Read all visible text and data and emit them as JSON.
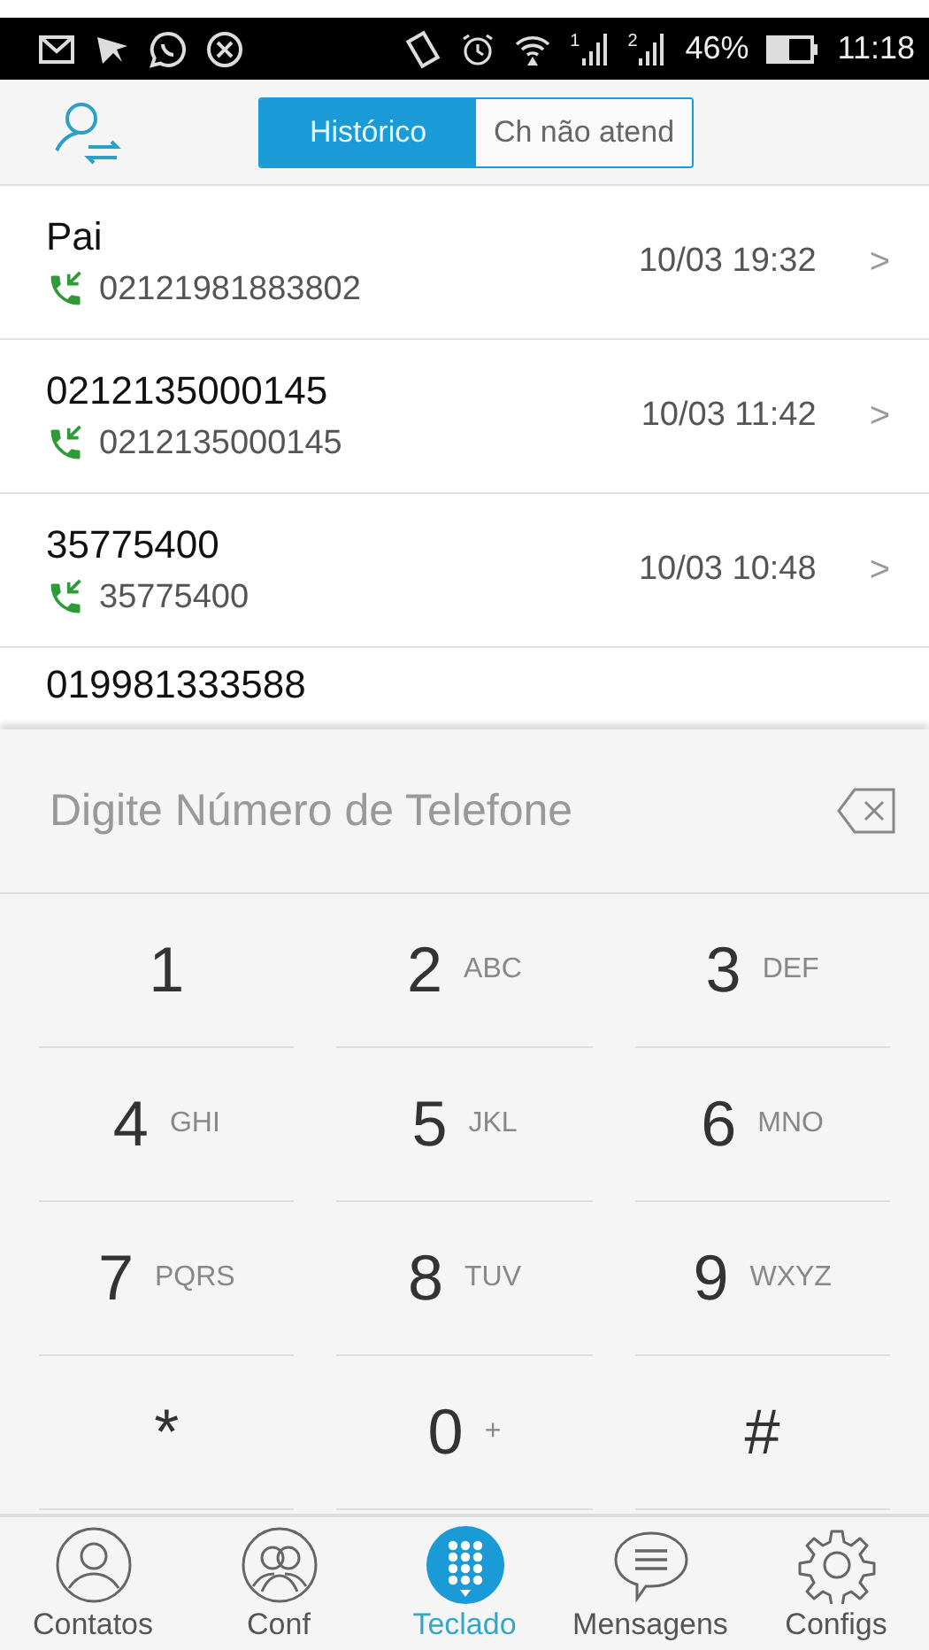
{
  "status_bar": {
    "sim_slots": [
      "1",
      "2"
    ],
    "battery": "46%",
    "time": "11:18"
  },
  "header": {
    "tabs": [
      {
        "label": "Histórico",
        "selected": true
      },
      {
        "label": "Ch não atend",
        "selected": false
      }
    ]
  },
  "calls": [
    {
      "name": "Pai",
      "number": "02121981883802",
      "time": "10/03 19:32",
      "chevron": ">"
    },
    {
      "name": "0212135000145",
      "number": "0212135000145",
      "time": "10/03 11:42",
      "chevron": ">"
    },
    {
      "name": "35775400",
      "number": "35775400",
      "time": "10/03 10:48",
      "chevron": ">"
    },
    {
      "name": "019981333588"
    }
  ],
  "dialer": {
    "placeholder": "Digite Número de Telefone",
    "keys": [
      {
        "digit": "1"
      },
      {
        "digit": "2",
        "letters": "ABC"
      },
      {
        "digit": "3",
        "letters": "DEF"
      },
      {
        "digit": "4",
        "letters": "GHI"
      },
      {
        "digit": "5",
        "letters": "JKL"
      },
      {
        "digit": "6",
        "letters": "MNO"
      },
      {
        "digit": "7",
        "letters": "PQRS"
      },
      {
        "digit": "8",
        "letters": "TUV"
      },
      {
        "digit": "9",
        "letters": "WXYZ"
      },
      {
        "digit": "*"
      },
      {
        "digit": "0",
        "letters": "+"
      },
      {
        "digit": "#"
      }
    ]
  },
  "nav": [
    {
      "kind": "contacts",
      "label": "Contatos",
      "selected": false
    },
    {
      "kind": "conf",
      "label": "Conf",
      "selected": false
    },
    {
      "kind": "keypad",
      "label": "Teclado",
      "selected": true
    },
    {
      "kind": "messages",
      "label": "Mensagens",
      "selected": false
    },
    {
      "kind": "settings",
      "label": "Configs",
      "selected": false
    }
  ]
}
